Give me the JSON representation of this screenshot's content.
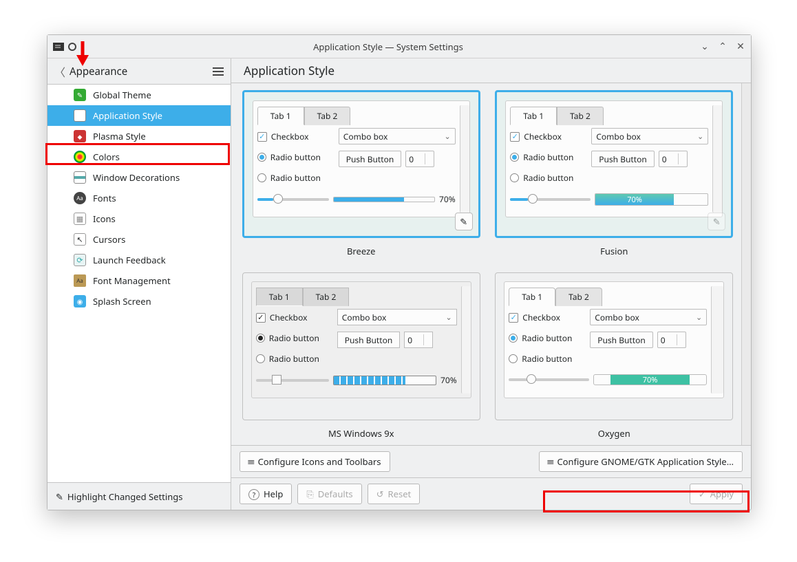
{
  "title": "Application Style — System Settings",
  "sidebar": {
    "back_label": "Appearance",
    "items": [
      {
        "label": "Global Theme"
      },
      {
        "label": "Application Style"
      },
      {
        "label": "Plasma Style"
      },
      {
        "label": "Colors"
      },
      {
        "label": "Window Decorations"
      },
      {
        "label": "Fonts"
      },
      {
        "label": "Icons"
      },
      {
        "label": "Cursors"
      },
      {
        "label": "Launch Feedback"
      },
      {
        "label": "Font Management"
      },
      {
        "label": "Splash Screen"
      }
    ],
    "footer": "Highlight Changed Settings"
  },
  "content": {
    "heading": "Application Style",
    "configure_icons": "Configure Icons and Toolbars",
    "configure_gtk": "Configure GNOME/GTK Application Style…",
    "help": "Help",
    "defaults": "Defaults",
    "reset": "Reset",
    "apply": "Apply"
  },
  "preview_labels": {
    "tab1": "Tab 1",
    "tab2": "Tab 2",
    "checkbox": "Checkbox",
    "radio": "Radio button",
    "combo": "Combo box",
    "push": "Push Button",
    "spin": "0",
    "pct": "70%"
  },
  "styles": [
    {
      "name": "Breeze",
      "selected": true
    },
    {
      "name": "Fusion",
      "selected": true
    },
    {
      "name": "MS Windows 9x",
      "selected": false
    },
    {
      "name": "Oxygen",
      "selected": false
    }
  ],
  "colors": {
    "accent": "#3daee9"
  }
}
